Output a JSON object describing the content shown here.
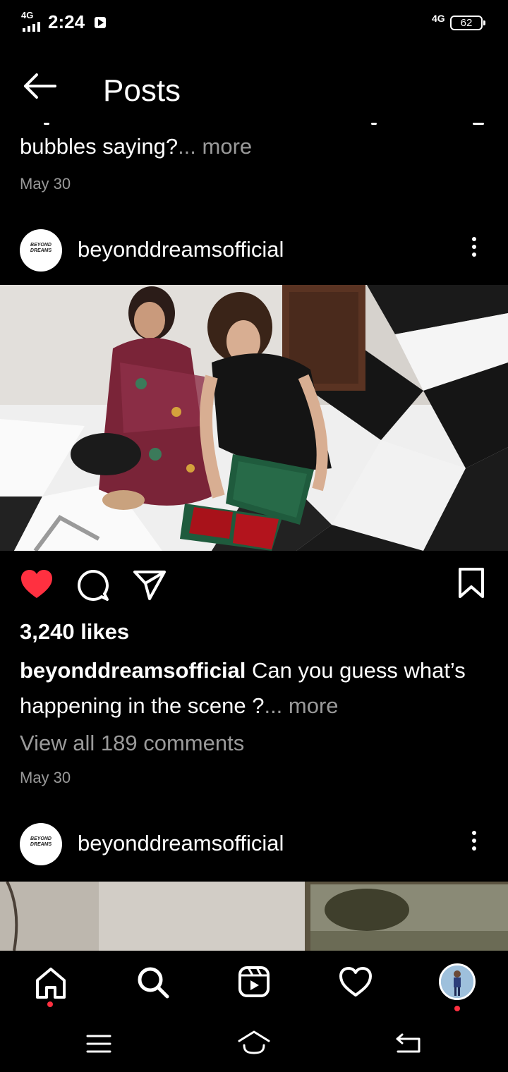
{
  "status_bar": {
    "network": "4G",
    "time": "2:24",
    "network_right": "4G",
    "battery": "62"
  },
  "header": {
    "title": "Posts"
  },
  "previous_post": {
    "caption_end": "bubbles saying?",
    "more": "... more",
    "date": "May 30"
  },
  "post": {
    "username": "beyonddreamsofficial",
    "avatar_text": "BEYOND DREAMS",
    "likes": "3,240 likes",
    "caption_user": "beyonddreamsofficial",
    "caption_text": " Can you guess what’s happening in the scene ?",
    "more": "... more",
    "view_comments": "View all 189 comments",
    "date": "May 30",
    "liked": true
  },
  "next_post": {
    "username": "beyonddreamsofficial",
    "avatar_text": "BEYOND DREAMS"
  },
  "colors": {
    "background": "#000000",
    "like_red": "#ff3040",
    "muted_text": "#9a9a9a"
  },
  "icons": {
    "back": "arrow-left-icon",
    "more": "more-vertical-icon",
    "like": "heart-filled-icon",
    "comment": "comment-icon",
    "share": "send-icon",
    "save": "bookmark-icon",
    "home": "home-icon",
    "search": "search-icon",
    "reels": "reels-icon",
    "activity": "heart-outline-icon",
    "profile": "profile-avatar"
  }
}
